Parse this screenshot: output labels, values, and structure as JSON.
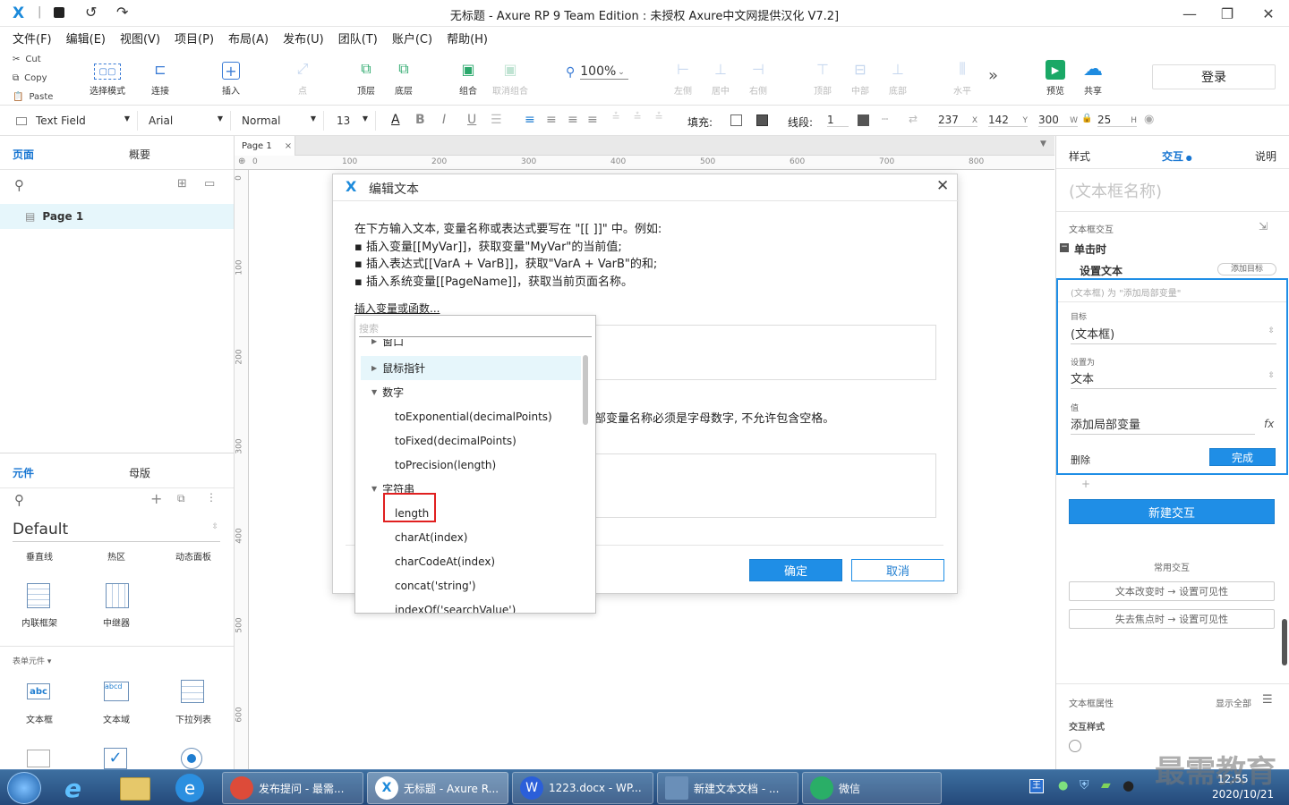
{
  "window": {
    "title": "无标题 - Axure RP 9 Team Edition : 未授权     Axure中文网提供汉化 V7.2]"
  },
  "menu": [
    "文件(F)",
    "编辑(E)",
    "视图(V)",
    "项目(P)",
    "布局(A)",
    "发布(U)",
    "团队(T)",
    "账户(C)",
    "帮助(H)"
  ],
  "clipboard": {
    "cut": "Cut",
    "copy": "Copy",
    "paste": "Paste"
  },
  "toolbar": {
    "select_mode": "选择模式",
    "connect": "连接",
    "insert": "插入",
    "point": "点",
    "top": "顶层",
    "bottom": "底层",
    "group": "组合",
    "ungroup": "取消组合",
    "zoom": "100%",
    "left": "左侧",
    "center": "居中",
    "right": "右侧",
    "top_align": "顶部",
    "middle": "中部",
    "bottom_align": "底部",
    "horizontal": "水平",
    "preview": "预览",
    "share": "共享",
    "login": "登录"
  },
  "format": {
    "widget_type": "Text Field",
    "font": "Arial",
    "style": "Normal",
    "size": "13",
    "fill_label": "填充:",
    "line_label": "线段:",
    "line_width": "1",
    "x": "237",
    "x_label": "X",
    "y": "142",
    "y_label": "Y",
    "w": "300",
    "w_label": "W",
    "h": "25",
    "h_label": "H"
  },
  "left_panel": {
    "tabs": [
      "页面",
      "概要"
    ],
    "pages": [
      "Page 1"
    ],
    "lib_tabs": [
      "元件",
      "母版"
    ],
    "library": "Default",
    "widgets_row1": [
      "垂直线",
      "热区",
      "动态面板"
    ],
    "widgets_row2": [
      "内联框架",
      "中继器"
    ],
    "form_section": "表单元件",
    "widgets_row3": [
      "文本框",
      "文本域",
      "下拉列表"
    ]
  },
  "canvas": {
    "page_tab": "Page 1",
    "ruler_h": [
      "0",
      "100",
      "200",
      "300",
      "400",
      "500",
      "600",
      "700",
      "800"
    ],
    "ruler_v": [
      "0",
      "100",
      "200",
      "300",
      "400",
      "500",
      "600"
    ]
  },
  "dialog": {
    "title": "编辑文本",
    "desc": [
      "在下方输入文本, 变量名称或表达式要写在 \"[[ ]]\" 中。例如:",
      "▪ 插入变量[[MyVar]]，获取变量\"MyVar\"的当前值;",
      "▪ 插入表达式[[VarA + VarB]]，获取\"VarA + VarB\"的和;",
      "▪ 插入系统变量[[PageName]]，获取当前页面名称。"
    ],
    "insert_link": "插入变量或函数...",
    "local_var_note": "部变量名称必须是字母数字, 不允许包含空格。",
    "ok": "确定",
    "cancel": "取消"
  },
  "function_popup": {
    "search_placeholder": "搜索",
    "items": [
      {
        "label": "窗口",
        "kind": "group-collapsed"
      },
      {
        "label": "鼠标指针",
        "kind": "group-collapsed"
      },
      {
        "label": "数字",
        "kind": "group-expanded"
      },
      {
        "label": "toExponential(decimalPoints)",
        "kind": "child"
      },
      {
        "label": "toFixed(decimalPoints)",
        "kind": "child"
      },
      {
        "label": "toPrecision(length)",
        "kind": "child"
      },
      {
        "label": "字符串",
        "kind": "group-expanded"
      },
      {
        "label": "length",
        "kind": "child"
      },
      {
        "label": "charAt(index)",
        "kind": "child"
      },
      {
        "label": "charCodeAt(index)",
        "kind": "child"
      },
      {
        "label": "concat('string')",
        "kind": "child"
      },
      {
        "label": "indexOf('searchValue')",
        "kind": "child"
      }
    ],
    "highlighted": "length"
  },
  "right_panel": {
    "tabs": [
      "样式",
      "交互",
      "说明"
    ],
    "widget_name": "(文本框名称)",
    "interaction_section": "文本框交互",
    "event": "单击时",
    "action": "设置文本",
    "add_target": "添加目标",
    "action_summary": "(文本框) 为 \"添加局部变量\"",
    "target_label": "目标",
    "target_value": "(文本框)",
    "set_to_label": "设置为",
    "set_to_value": "文本",
    "value_label": "值",
    "value_value": "添加局部变量",
    "delete": "删除",
    "done": "完成",
    "new_interaction": "新建交互",
    "common_label": "常用交互",
    "common1": "文本改变时 → 设置可见性",
    "common2": "失去焦点时 → 设置可见性",
    "props_label": "文本框属性",
    "show_all": "显示全部",
    "interaction_style": "交互样式"
  },
  "taskbar": {
    "apps": [
      {
        "label": "发布提问 - 最需...",
        "color": "#dd4b39"
      },
      {
        "label": "无标题 - Axure R...",
        "color": "#2a7bd3"
      },
      {
        "label": "1223.docx - WP...",
        "color": "#2b5fd9"
      },
      {
        "label": "新建文本文档 - ...",
        "color": "#6a8fb8"
      },
      {
        "label": "微信",
        "color": "#2aae67"
      }
    ],
    "time": "12:55",
    "date": "2020/10/21",
    "watermark": "最需教育"
  }
}
